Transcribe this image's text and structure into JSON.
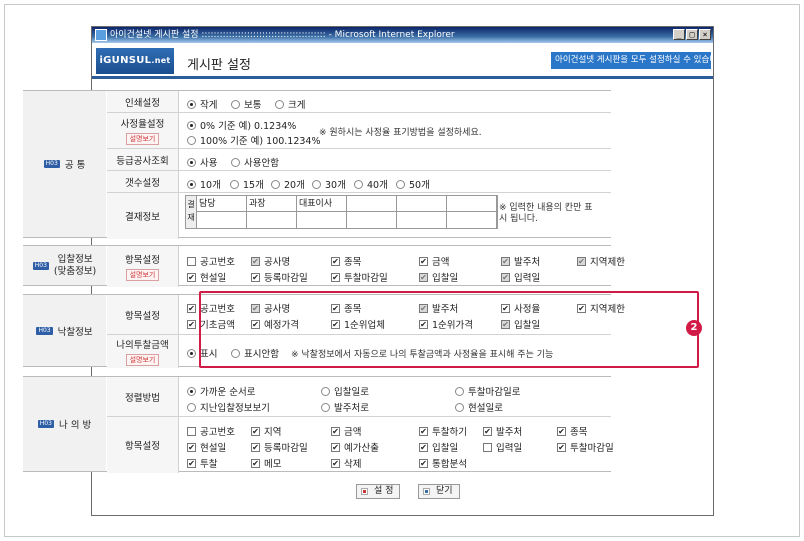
{
  "window": {
    "title": "아이건설넷 게시판 설정 ::::::::::::::::::::::::::::::::::::::::: - Microsoft Internet Explorer",
    "btn_min": "_",
    "btn_max": "□",
    "btn_close": "×"
  },
  "header": {
    "logo": "iGUNSUL",
    "logo_suffix": ".net",
    "title": "게시판 설정",
    "set_all": "아이건설넷 게시판을 모두 설정하실 수 있습니다."
  },
  "tag": "H03",
  "tip": "설명보기",
  "common": {
    "label": "공 통",
    "print": {
      "label": "인쇄설정",
      "options": [
        "작게",
        "보통",
        "크게"
      ]
    },
    "rate": {
      "label": "사정율설정",
      "options": [
        "0% 기준   예) 0.1234%",
        "100% 기준  예) 100.1234%"
      ],
      "note": "※ 원하시는 사정율 표기방법을 설정하세요."
    },
    "grade": {
      "label": "등급공사조회",
      "options": [
        "사용",
        "사용안함"
      ]
    },
    "count": {
      "label": "갯수설정",
      "options": [
        "10개",
        "15개",
        "20개",
        "30개",
        "40개",
        "50개"
      ]
    },
    "approval": {
      "label": "결재정보",
      "side": "결재",
      "cells": [
        "담당",
        "과장",
        "대표이사",
        "",
        "",
        ""
      ],
      "note": "※ 입력한 내용의 칸만 표시 됩니다."
    }
  },
  "bid": {
    "label": "입찰정보",
    "label2": "(맞춤정보)",
    "row_label": "항목설정",
    "items": [
      "공고번호",
      "공사명",
      "종목",
      "금액",
      "발주처",
      "지역제한",
      "현설일",
      "등록마감일",
      "투찰마감일",
      "입찰일",
      "입력일"
    ]
  },
  "award": {
    "label": "낙찰정보",
    "row_label": "항목설정",
    "items": [
      "공고번호",
      "공사명",
      "종목",
      "발주처",
      "사정율",
      "지역제한",
      "기초금액",
      "예정가격",
      "1순위업체",
      "1순위가격",
      "입찰일"
    ],
    "mybid": {
      "label": "나의투찰금액",
      "options": [
        "표시",
        "표시안함"
      ],
      "note": "※ 낙찰정보에서 자동으로 나의 투찰금액과 사정율을 표시해 주는 기능"
    },
    "badge": "2"
  },
  "my": {
    "label": "나 의 방",
    "sort": {
      "label": "정렬방법",
      "options": [
        "가까운 순서로",
        "입찰일로",
        "투찰마감일로",
        "지난입찰정보보기",
        "발주처로",
        "현설일로"
      ]
    },
    "row_label": "항목설정",
    "items": [
      "공고번호",
      "지역",
      "금액",
      "투찰하기",
      "발주처",
      "종목",
      "현설일",
      "등록마감일",
      "예가산출",
      "입찰일",
      "입력일",
      "투찰마감일",
      "투찰",
      "메모",
      "삭제",
      "통합분석"
    ]
  },
  "buttons": {
    "save": "설 정",
    "close": "닫기"
  }
}
